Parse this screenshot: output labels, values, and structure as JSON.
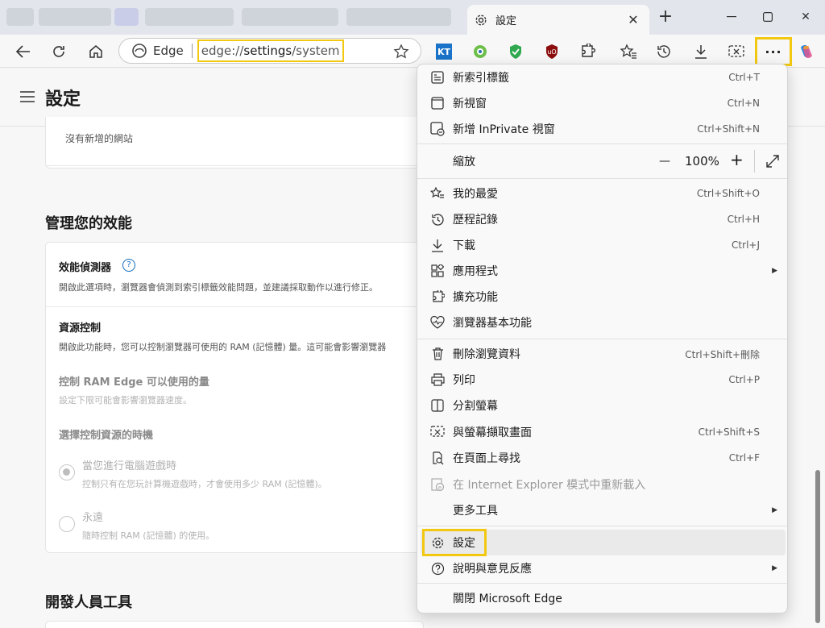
{
  "tab": {
    "title": "設定",
    "close": "✕"
  },
  "window": {
    "minimize": "—",
    "maximize": "☐",
    "close": "✕",
    "new_tab": "+"
  },
  "toolbar": {
    "site_label": "Edge",
    "url_prefix": "edge://",
    "url_bold": "settings",
    "url_suffix": "/system",
    "more": "···",
    "ext_kt": "KT"
  },
  "page": {
    "title": "設定",
    "no_sites": "沒有新增的網站",
    "perf_section": "管理您的效能",
    "detector_title": "效能偵測器",
    "detector_desc": "開啟此選項時，瀏覽器會偵測到索引標籤效能問題，並建議採取動作以進行修正。",
    "resource_title": "資源控制",
    "resource_desc": "開啟此功能時，您可以控制瀏覽器可使用的 RAM (記憶體) 量。這可能會影響瀏覽器",
    "ram_title": "控制 RAM Edge 可以使用的量",
    "ram_desc": "設定下限可能會影響瀏覽器速度。",
    "when_title": "選擇控制資源的時機",
    "opt1_title": "當您進行電腦遊戲時",
    "opt1_desc": "控制只有在您玩計算機遊戲時，才會使用多少 RAM (記憶體)。",
    "opt2_title": "永遠",
    "opt2_desc": "隨時控制 RAM (記憶體) 的使用。",
    "dev_section": "開發人員工具"
  },
  "menu": {
    "new_tab": {
      "label": "新索引標籤",
      "shortcut": "Ctrl+T"
    },
    "new_window": {
      "label": "新視窗",
      "shortcut": "Ctrl+N"
    },
    "new_inprivate": {
      "label": "新增 InPrivate 視窗",
      "shortcut": "Ctrl+Shift+N"
    },
    "zoom": {
      "label": "縮放",
      "minus": "—",
      "value": "100%",
      "plus": "+"
    },
    "favorites": {
      "label": "我的最愛",
      "shortcut": "Ctrl+Shift+O"
    },
    "history": {
      "label": "歷程記錄",
      "shortcut": "Ctrl+H"
    },
    "downloads": {
      "label": "下載",
      "shortcut": "Ctrl+J"
    },
    "apps": {
      "label": "應用程式"
    },
    "extensions": {
      "label": "擴充功能"
    },
    "essentials": {
      "label": "瀏覽器基本功能"
    },
    "delete_data": {
      "label": "刪除瀏覽資料",
      "shortcut": "Ctrl+Shift+刪除"
    },
    "print": {
      "label": "列印",
      "shortcut": "Ctrl+P"
    },
    "split": {
      "label": "分割螢幕"
    },
    "screenshot": {
      "label": "與螢幕擷取畫面",
      "shortcut": "Ctrl+Shift+S"
    },
    "find": {
      "label": "在頁面上尋找",
      "shortcut": "Ctrl+F"
    },
    "ie_mode": {
      "label": "在 Internet Explorer 模式中重新載入"
    },
    "more_tools": {
      "label": "更多工具"
    },
    "settings": {
      "label": "設定"
    },
    "help": {
      "label": "說明與意見反應"
    },
    "close_edge": {
      "label": "關閉 Microsoft Edge"
    }
  },
  "colors": {
    "highlight": "#f2c811",
    "accent": "#0f6cbd"
  }
}
